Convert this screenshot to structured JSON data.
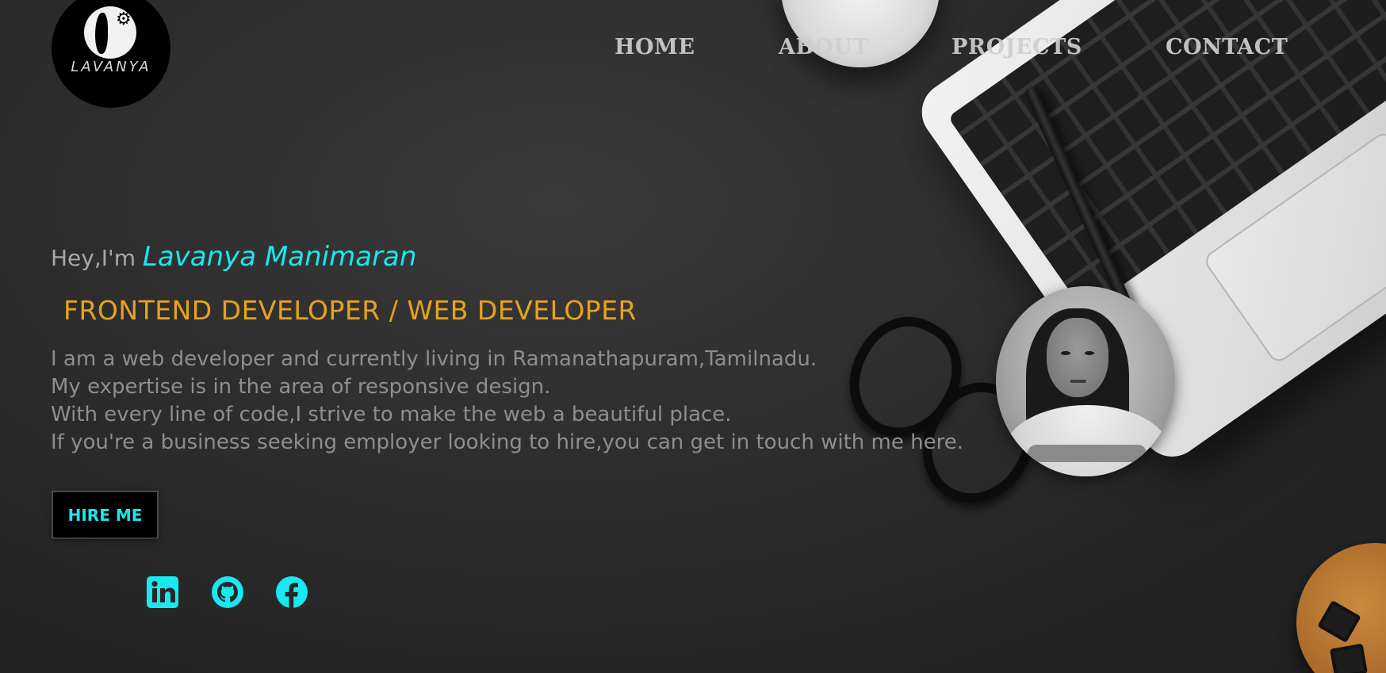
{
  "logo": {
    "text": "LAVANYA",
    "icon": "woman-silhouette-gear-icon"
  },
  "nav": {
    "items": [
      {
        "label": "HOME"
      },
      {
        "label": "ABOUT"
      },
      {
        "label": "PROJECTS"
      },
      {
        "label": "CONTACT"
      }
    ]
  },
  "hero": {
    "greeting_prefix": "Hey,I'm ",
    "name": "Lavanya Manimaran",
    "role": "FRONTEND DEVELOPER / WEB DEVELOPER",
    "bio": [
      "I am a web developer and currently living in Ramanathapuram,Tamilnadu.",
      "My expertise is in the area of responsive design.",
      "With every line of code,I strive to make the web a beautiful place.",
      "If you're a business seeking employer looking to hire,you can get in touch with me here."
    ],
    "hire_button": "HIRE ME"
  },
  "socials": [
    {
      "icon": "linkedin-icon"
    },
    {
      "icon": "github-icon"
    },
    {
      "icon": "facebook-icon"
    }
  ],
  "colors": {
    "accent_cyan": "#19e8ee",
    "accent_orange": "#e8a31b",
    "text_gray": "#8e8e8e",
    "background": "#2b2b2b"
  }
}
